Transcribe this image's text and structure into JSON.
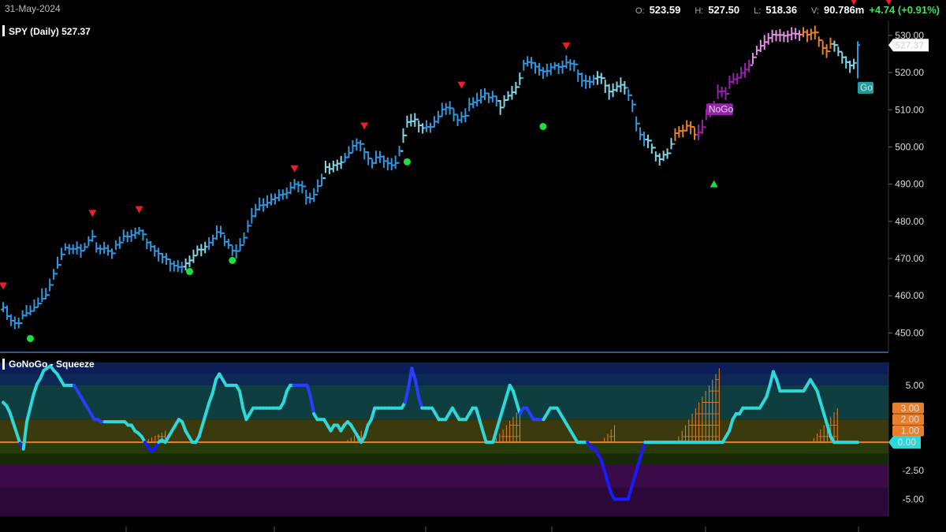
{
  "header": {
    "date": "31-May-2024",
    "open_label": "O:",
    "open": "523.59",
    "high_label": "H:",
    "high": "527.50",
    "low_label": "L:",
    "low": "518.36",
    "volume_label": "V:",
    "volume": "90.786m",
    "change": "+4.74 (+0.91%)"
  },
  "chart_data": [
    {
      "type": "ohlc",
      "title": "SPY (Daily) 527.37",
      "last_price_label": "527.37",
      "ylim": [
        445,
        534
      ],
      "y_ticks": [
        "530.00",
        "520.00",
        "510.00",
        "500.00",
        "490.00",
        "480.00",
        "470.00",
        "460.00",
        "450.00"
      ],
      "grid": false,
      "colors": {
        "go_strong": "#2f97e0",
        "go_weak": "#7fd8e6",
        "nogo_weak": "#e58ee3",
        "nogo_strong": "#9a1fb0",
        "neutral": "#e87f2b"
      },
      "annotations": [
        {
          "text": "NoGo",
          "bar": 181,
          "price": 510.0,
          "color": "#9a1fb0"
        },
        {
          "text": "Go",
          "bar": 220,
          "price": 515.8,
          "color": "#1f9fa3"
        }
      ],
      "closes": [
        456.8,
        454.5,
        453.3,
        452.6,
        452.6,
        454.7,
        455.3,
        455.9,
        456.9,
        457.9,
        459.2,
        460.2,
        462.9,
        465.9,
        468.3,
        471.1,
        472.9,
        472.6,
        472.6,
        472.9,
        472.1,
        473.1,
        474.9,
        475.9,
        472.7,
        472.6,
        472.8,
        472.0,
        471.4,
        473.7,
        474.3,
        476.0,
        475.9,
        476.3,
        476.9,
        477.5,
        476.5,
        474.3,
        473.2,
        472.0,
        471.3,
        470.4,
        469.8,
        468.6,
        468.1,
        467.7,
        467.8,
        468.7,
        469.5,
        470.8,
        472.4,
        472.4,
        473.2,
        474.3,
        475.4,
        477.1,
        476.8,
        474.5,
        473.6,
        472.1,
        472.0,
        473.6,
        475.6,
        478.8,
        481.4,
        483.2,
        484.3,
        484.4,
        485.0,
        485.9,
        486.3,
        487.1,
        487.3,
        487.7,
        489.1,
        490.0,
        489.7,
        489.4,
        486.4,
        486.1,
        487.2,
        489.5,
        491.6,
        494.6,
        494.1,
        495.1,
        495.5,
        495.9,
        497.2,
        498.4,
        500.3,
        501.1,
        500.8,
        498.6,
        496.9,
        495.7,
        497.2,
        497.4,
        496.2,
        495.6,
        495.1,
        495.7,
        498.9,
        503.1,
        506.7,
        506.9,
        507.4,
        505.8,
        505.1,
        505.4,
        505.4,
        506.8,
        508.2,
        510.1,
        510.6,
        510.4,
        508.7,
        507.2,
        508.2,
        508.4,
        511.5,
        512.0,
        512.5,
        513.5,
        514.4,
        513.3,
        513.6,
        512.4,
        510.6,
        512.6,
        513.8,
        514.7,
        516.1,
        518.5,
        522.4,
        522.8,
        522.6,
        521.6,
        520.6,
        520.3,
        520.4,
        521.4,
        521.9,
        521.5,
        521.7,
        522.7,
        522.4,
        522.2,
        519.6,
        517.8,
        517.7,
        517.5,
        518.4,
        518.8,
        518.5,
        516.5,
        514.9,
        515.3,
        516.3,
        516.7,
        515.9,
        513.9,
        511.4,
        506.3,
        503.3,
        502.0,
        501.7,
        499.8,
        497.6,
        496.7,
        497.9,
        498.3,
        500.8,
        503.7,
        504.3,
        504.4,
        505.7,
        505.4,
        503.3,
        503.9,
        505.3,
        508.9,
        510.1,
        511.0,
        514.9,
        515.0,
        514.3,
        517.5,
        518.2,
        518.6,
        519.9,
        520.8,
        522.0,
        524.1,
        526.0,
        527.2,
        528.2,
        529.3,
        530.2,
        530.1,
        530.1,
        529.9,
        530.1,
        530.5,
        530.4,
        530.2,
        530.9,
        530.2,
        530.7,
        530.8,
        528.7,
        526.6,
        525.7,
        527.7,
        527.4,
        525.6,
        524.1,
        522.8,
        521.9,
        522.6,
        527.4
      ],
      "highs": [
        458.3,
        457.4,
        455.0,
        454.4,
        454.1,
        456.1,
        457.5,
        457.4,
        459.0,
        459.5,
        462.0,
        462.1,
        464.6,
        467.2,
        470.5,
        472.9,
        474.1,
        473.9,
        473.8,
        474.6,
        473.9,
        474.2,
        476.0,
        477.7,
        474.4,
        473.7,
        474.5,
        473.7,
        472.7,
        474.9,
        475.9,
        477.8,
        477.3,
        477.8,
        478.3,
        478.5,
        477.8,
        475.4,
        474.7,
        473.6,
        472.9,
        471.5,
        471.5,
        469.9,
        469.4,
        469.6,
        469.1,
        470.0,
        470.8,
        472.4,
        473.5,
        473.9,
        474.5,
        475.7,
        476.4,
        478.9,
        478.8,
        476.3,
        475.3,
        473.4,
        473.8,
        475.5,
        477.0,
        480.3,
        483.6,
        484.7,
        486.4,
        486.2,
        487.0,
        487.5,
        487.5,
        488.6,
        488.6,
        489.1,
        490.6,
        491.4,
        490.8,
        490.9,
        488.5,
        487.7,
        488.9,
        491.3,
        492.8,
        496.3,
        495.7,
        496.3,
        496.6,
        497.6,
        498.4,
        500.2,
        501.8,
        502.3,
        501.8,
        499.8,
        498.8,
        496.8,
        499.0,
        498.9,
        497.7,
        497.2,
        497.0,
        497.7,
        500.3,
        505.0,
        508.4,
        508.9,
        509.1,
        507.1,
        506.4,
        507.2,
        506.5,
        508.3,
        509.7,
        511.9,
        511.8,
        512.3,
        510.3,
        508.6,
        509.5,
        510.4,
        513.2,
        513.4,
        514.6,
        515.5,
        515.8,
        514.5,
        515.1,
        513.8,
        512.6,
        513.9,
        515.0,
        516.4,
        517.5,
        520.0,
        523.4,
        524.4,
        524.2,
        522.8,
        522.6,
        521.5,
        522.4,
        522.6,
        522.8,
        522.6,
        523.2,
        524.6,
        523.6,
        523.4,
        520.8,
        520.0,
        519.4,
        519.1,
        519.4,
        520.4,
        519.9,
        518.1,
        516.9,
        517.1,
        517.6,
        518.7,
        517.7,
        515.5,
        512.7,
        508.2,
        505.3,
        504.1,
        503.3,
        500.9,
        498.8,
        498.3,
        499.0,
        499.6,
        502.4,
        505.0,
        505.6,
        506.0,
        507.2,
        506.9,
        505.3,
        506.0,
        507.3,
        510.2,
        511.7,
        512.4,
        516.8,
        516.2,
        516.1,
        519.2,
        519.9,
        519.8,
        521.5,
        522.6,
        523.5,
        525.3,
        527.2,
        528.8,
        530.1,
        530.6,
        531.5,
        531.4,
        531.7,
        531.0,
        531.3,
        532.2,
        532.0,
        531.4,
        532.2,
        531.6,
        531.8,
        532.6,
        529.7,
        528.5,
        527.6,
        529.4,
        528.6,
        527.0,
        525.5,
        524.4,
        523.2,
        523.7,
        528.4
      ],
      "lows": [
        455.6,
        453.5,
        451.8,
        451.0,
        451.2,
        453.6,
        454.4,
        454.7,
        455.7,
        456.9,
        458.3,
        459.1,
        461.2,
        464.3,
        467.3,
        469.6,
        472.1,
        471.1,
        471.2,
        471.1,
        470.2,
        472.2,
        473.4,
        474.5,
        471.6,
        471.1,
        471.3,
        470.8,
        469.9,
        472.3,
        472.6,
        474.6,
        474.4,
        474.5,
        475.3,
        476.3,
        474.8,
        472.5,
        471.9,
        470.5,
        469.2,
        468.7,
        468.3,
        466.5,
        466.5,
        466.4,
        466.1,
        466.8,
        467.7,
        468.8,
        470.9,
        470.6,
        471.4,
        472.3,
        473.4,
        475.0,
        475.6,
        473.3,
        472.6,
        470.7,
        470.0,
        472.0,
        473.9,
        477.0,
        479.4,
        481.1,
        482.9,
        482.6,
        483.6,
        484.3,
        484.5,
        485.4,
        485.8,
        486.0,
        487.3,
        488.5,
        487.8,
        487.5,
        484.5,
        484.8,
        485.2,
        487.8,
        489.5,
        493.0,
        492.7,
        493.2,
        493.6,
        494.1,
        495.9,
        497.1,
        498.5,
        499.0,
        498.8,
        496.6,
        495.1,
        494.2,
        495.4,
        495.7,
        494.4,
        493.7,
        493.7,
        494.1,
        497.5,
        501.1,
        505.2,
        505.5,
        505.4,
        503.9,
        503.6,
        504.0,
        503.8,
        505.3,
        506.3,
        508.1,
        508.6,
        508.7,
        506.9,
        505.6,
        506.4,
        506.6,
        509.6,
        510.4,
        510.9,
        511.7,
        512.6,
        511.8,
        512.0,
        510.9,
        508.6,
        510.8,
        512.5,
        512.7,
        514.1,
        516.6,
        520.5,
        521.6,
        521.0,
        519.7,
        519.2,
        518.3,
        518.9,
        519.3,
        520.7,
        519.6,
        519.7,
        521.1,
        520.5,
        520.3,
        517.5,
        516.2,
        515.6,
        515.8,
        516.6,
        516.7,
        516.9,
        514.5,
        512.7,
        513.4,
        514.8,
        514.7,
        514.1,
        512.4,
        509.4,
        504.2,
        501.8,
        500.2,
        499.7,
        498.2,
        496.1,
        495.0,
        496.2,
        496.8,
        499.4,
        501.6,
        502.5,
        502.6,
        504.2,
        503.4,
        501.9,
        501.8,
        503.5,
        507.2,
        508.0,
        509.2,
        512.9,
        513.4,
        512.6,
        515.6,
        516.9,
        516.9,
        518.4,
        518.6,
        520.1,
        522.3,
        524.7,
        525.5,
        526.1,
        527.5,
        528.1,
        528.4,
        528.3,
        528.2,
        528.1,
        528.7,
        529.0,
        528.5,
        529.5,
        528.2,
        528.7,
        528.9,
        526.9,
        524.8,
        523.9,
        526.4,
        525.6,
        524.4,
        522.4,
        521.1,
        519.9,
        520.9,
        518.4
      ],
      "zones": [
        {
          "from": 0,
          "to": 46,
          "color": "go_strong"
        },
        {
          "from": 47,
          "to": 52,
          "color": "go_weak"
        },
        {
          "from": 53,
          "to": 82,
          "color": "go_strong"
        },
        {
          "from": 83,
          "to": 87,
          "color": "go_weak"
        },
        {
          "from": 88,
          "to": 102,
          "color": "go_strong"
        },
        {
          "from": 103,
          "to": 108,
          "color": "go_weak"
        },
        {
          "from": 109,
          "to": 127,
          "color": "go_strong"
        },
        {
          "from": 128,
          "to": 133,
          "color": "go_weak"
        },
        {
          "from": 134,
          "to": 152,
          "color": "go_strong"
        },
        {
          "from": 153,
          "to": 160,
          "color": "go_weak"
        },
        {
          "from": 161,
          "to": 165,
          "color": "go_strong"
        },
        {
          "from": 166,
          "to": 172,
          "color": "go_weak"
        },
        {
          "from": 173,
          "to": 178,
          "color": "neutral"
        },
        {
          "from": 179,
          "to": 192,
          "color": "nogo_strong"
        },
        {
          "from": 193,
          "to": 205,
          "color": "nogo_weak"
        },
        {
          "from": 206,
          "to": 213,
          "color": "neutral"
        },
        {
          "from": 214,
          "to": 219,
          "color": "go_weak"
        },
        {
          "from": 220,
          "to": 235,
          "color": "go_strong"
        },
        {
          "from": 236,
          "to": 247,
          "color": "go_weak"
        }
      ],
      "go_triangles_down": [
        {
          "bar": 0,
          "price": 462.5
        },
        {
          "bar": 23,
          "price": 482.0
        },
        {
          "bar": 35,
          "price": 483.0
        },
        {
          "bar": 75,
          "price": 494.0
        },
        {
          "bar": 93,
          "price": 505.5
        },
        {
          "bar": 118,
          "price": 516.5
        },
        {
          "bar": 145,
          "price": 527.0
        },
        {
          "bar": 219,
          "price": 539.0
        },
        {
          "bar": 228,
          "price": 539.0
        }
      ],
      "go_triangles_up": [
        {
          "bar": 183,
          "price": 490.0
        }
      ],
      "go_dots": [
        {
          "bar": 7,
          "price": 448.5
        },
        {
          "bar": 48,
          "price": 466.5
        },
        {
          "bar": 59,
          "price": 469.5
        },
        {
          "bar": 104,
          "price": 496.0
        },
        {
          "bar": 139,
          "price": 505.5
        }
      ]
    },
    {
      "type": "line",
      "title": "GoNoGo - Squeeze",
      "ylim": [
        -6.5,
        7.0
      ],
      "y_ticks": [
        "5.00",
        "-2.50",
        "-5.00"
      ],
      "level_labels": [
        "3.00",
        "2.00",
        "1.00"
      ],
      "zero_label": "0.00",
      "values": [
        3.5,
        3.2,
        2.6,
        1.7,
        0.8,
        -0.1,
        -0.6,
        1.8,
        3.0,
        4.2,
        5.1,
        5.6,
        6.3,
        6.5,
        6.7,
        6.3,
        6.0,
        5.5,
        5.0,
        5.0,
        5.0,
        5.0,
        4.5,
        4.0,
        3.5,
        3.0,
        2.5,
        2.0,
        2.0,
        1.8,
        1.8,
        1.8,
        1.8,
        1.8,
        1.8,
        1.8,
        1.8,
        1.5,
        1.5,
        1.0,
        0.8,
        0.5,
        0.0,
        -0.5,
        -0.8,
        -0.5,
        0.0,
        0.2,
        0.0,
        0.5,
        1.0,
        1.5,
        2.0,
        1.8,
        1.0,
        0.5,
        0.0,
        0.0,
        0.5,
        1.5,
        2.5,
        3.5,
        4.3,
        5.5,
        6.0,
        5.5,
        5.0,
        5.0,
        5.0,
        5.0,
        4.5,
        3.0,
        2.0,
        2.5,
        3.0,
        3.0,
        3.0,
        3.0,
        3.0,
        3.0,
        3.0,
        3.0,
        3.0,
        3.5,
        4.5,
        5.0,
        5.0,
        5.0,
        5.0,
        5.0,
        5.0,
        4.0,
        2.5,
        2.0,
        2.0,
        2.0,
        1.5,
        1.0,
        1.5,
        1.5,
        1.0,
        1.5,
        1.8,
        1.5,
        1.0,
        0.5,
        0.0,
        0.5,
        1.5,
        2.0,
        3.0,
        3.0,
        3.0,
        3.0,
        3.0,
        3.0,
        3.0,
        3.0,
        3.0,
        3.5,
        4.8,
        6.5,
        5.5,
        4.0,
        3.0,
        3.0,
        3.0,
        3.0,
        2.5,
        2.0,
        2.0,
        2.0,
        2.5,
        3.0,
        2.5,
        2.0,
        2.0,
        2.0,
        2.5,
        3.0,
        3.0,
        2.0,
        1.0,
        0.0,
        0.0,
        0.0,
        1.0,
        2.0,
        3.0,
        4.0,
        5.0,
        4.5,
        3.5,
        2.5,
        3.0,
        3.0,
        2.5,
        2.0,
        2.0,
        2.0,
        2.0,
        2.5,
        3.0,
        3.0,
        3.0,
        2.5,
        2.0,
        1.5,
        1.0,
        0.5,
        0.0,
        0.0,
        0.0,
        0.0,
        -0.5,
        -0.5,
        -1.0,
        -1.5,
        -2.5,
        -3.5,
        -4.5,
        -5.0,
        -5.0,
        -5.0,
        -5.0,
        -5.0,
        -4.0,
        -3.0,
        -2.0,
        -1.0,
        0.0,
        0.0,
        0.0,
        0.0,
        0.0,
        0.0,
        0.0,
        0.0,
        0.0,
        0.0,
        0.0,
        0.0,
        0.0,
        0.0,
        0.0,
        0.0,
        0.0,
        0.0,
        0.0,
        0.0,
        0.0,
        0.0,
        0.0,
        0.0,
        0.5,
        1.0,
        2.0,
        2.5,
        2.5,
        3.0,
        3.0,
        3.0,
        3.0,
        3.0,
        3.0,
        3.5,
        4.0,
        5.0,
        6.2,
        5.5,
        4.5,
        4.5,
        4.5,
        4.5,
        4.5,
        4.5,
        4.5,
        4.5,
        5.0,
        5.5,
        5.0,
        4.5,
        3.5,
        2.5,
        1.5,
        0.5,
        0.0,
        0.0,
        0.0,
        0.0,
        0.0,
        0.0,
        0.0,
        0.0
      ]
    }
  ]
}
